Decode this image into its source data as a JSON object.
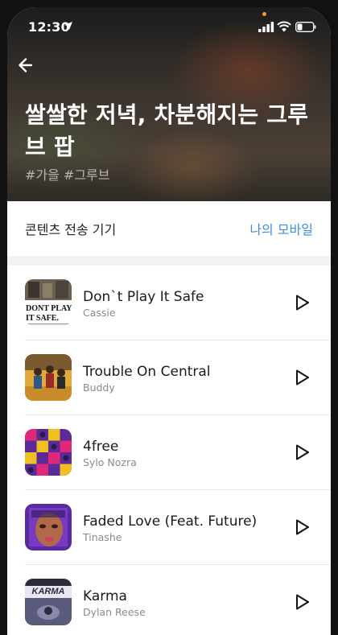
{
  "status": {
    "time": "12:30"
  },
  "header": {
    "title": "쌀쌀한 저녁, 차분해지는 그루브 팝",
    "tags": "#가을 #그루브"
  },
  "device": {
    "label": "콘텐츠 전송 기기",
    "link": "나의 모바일"
  },
  "tracks": [
    {
      "title": "Don`t Play It Safe",
      "artist": "Cassie",
      "art_text": "DONT PLAY IT SAFE."
    },
    {
      "title": "Trouble On Central",
      "artist": "Buddy"
    },
    {
      "title": "4free",
      "artist": "Sylo Nozra"
    },
    {
      "title": "Faded Love (Feat. Future)",
      "artist": "Tinashe"
    },
    {
      "title": "Karma",
      "artist": "Dylan Reese",
      "art_text": "KARMA"
    }
  ],
  "colors": {
    "accent": "#3d8fe0",
    "notification_dot": "#f59a23"
  }
}
